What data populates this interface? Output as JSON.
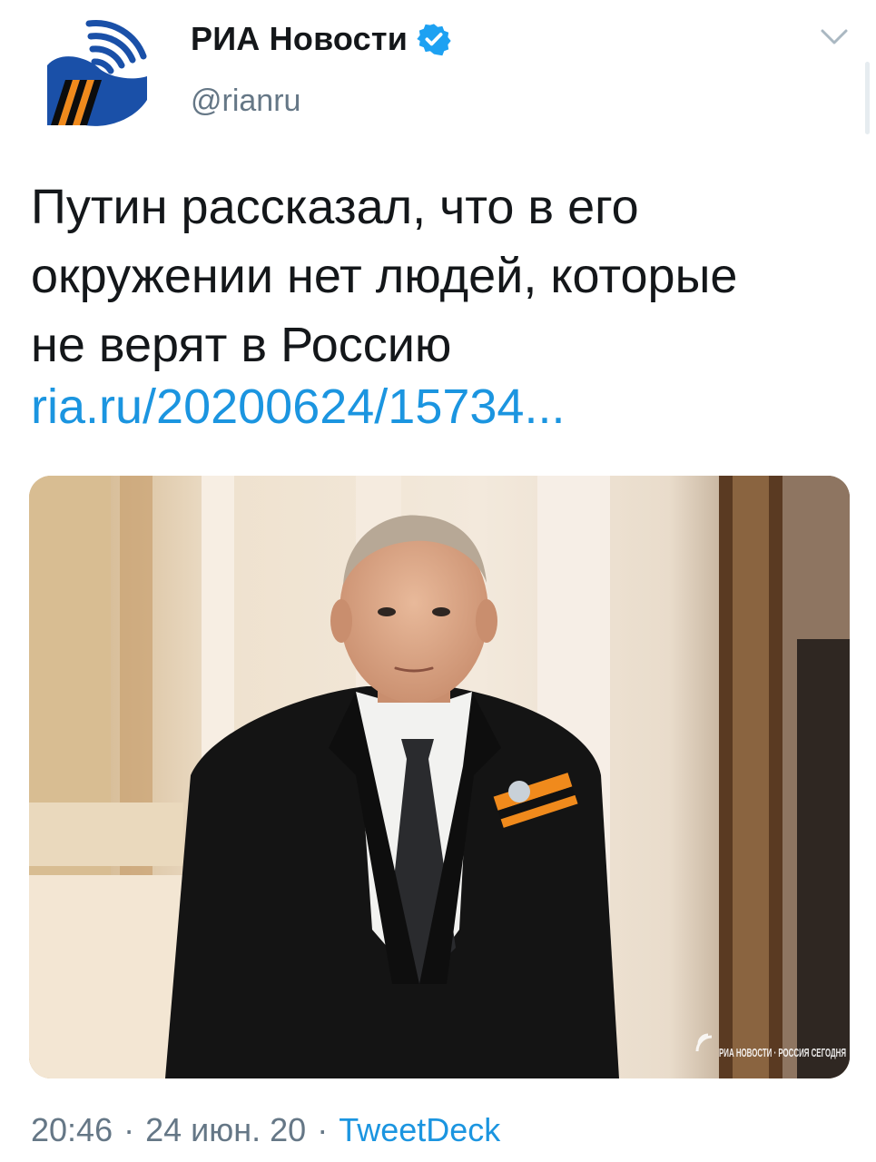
{
  "account": {
    "display_name": "РИА Новости",
    "handle": "@rianru",
    "verified": true,
    "avatar_icon": "ria-novosti-logo-icon",
    "avatar_colors": {
      "blue": "#1a50a8",
      "orange": "#f08a1c",
      "dark": "#0c0c0c"
    }
  },
  "tweet": {
    "text": "Путин рассказал, что в его\nокружении нет людей, которые\nне верят в Россию",
    "link": "ria.ru/20200624/15734..."
  },
  "media": {
    "type": "photo",
    "watermark": "РИА НОВОСТИ · РОССИЯ СЕГОДНЯ"
  },
  "meta": {
    "time": "20:46",
    "date": "24 июн. 20",
    "source": "TweetDeck",
    "separator": "·"
  },
  "colors": {
    "link": "#1b95e0",
    "secondary_text": "#657786",
    "primary_text": "#14171a",
    "verified_badge": "#1da1f2"
  }
}
